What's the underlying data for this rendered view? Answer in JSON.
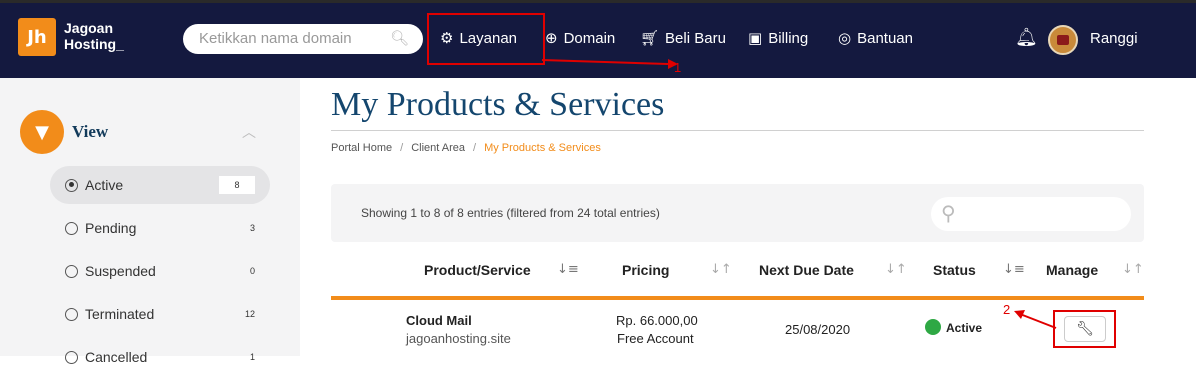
{
  "brand": {
    "logo_glyph": "Jh",
    "line1": "Jagoan",
    "line2": "Hosting_",
    "accent": "#f28c1a",
    "navbar_bg": "#14193f"
  },
  "search": {
    "placeholder": "Ketikkan nama domain"
  },
  "nav": [
    {
      "icon": "gears-icon",
      "label": "Layanan"
    },
    {
      "icon": "globe-icon",
      "label": "Domain"
    },
    {
      "icon": "cart-icon",
      "label": "Beli Baru"
    },
    {
      "icon": "billing-icon",
      "label": "Billing"
    },
    {
      "icon": "lifebuoy-icon",
      "label": "Bantuan"
    }
  ],
  "user": {
    "name": "Ranggi"
  },
  "annotations": {
    "step1": "1",
    "step2": "2",
    "color": "#e00000"
  },
  "sidebar": {
    "title": "View",
    "filters": [
      {
        "label": "Active",
        "count": "8",
        "selected": true
      },
      {
        "label": "Pending",
        "count": "3",
        "selected": false
      },
      {
        "label": "Suspended",
        "count": "0",
        "selected": false
      },
      {
        "label": "Terminated",
        "count": "12",
        "selected": false
      },
      {
        "label": "Cancelled",
        "count": "1",
        "selected": false
      }
    ]
  },
  "page": {
    "title": "My Products & Services",
    "breadcrumb": [
      "Portal Home",
      "Client Area",
      "My Products & Services"
    ]
  },
  "table": {
    "info": "Showing 1 to 8 of 8 entries (filtered from 24 total entries)",
    "columns": [
      "Product/Service",
      "Pricing",
      "Next Due Date",
      "Status",
      "Manage"
    ],
    "rows": [
      {
        "product": "Cloud Mail",
        "domain": "jagoanhosting.site",
        "price": "Rp. 66.000,00",
        "price_note": "Free Account",
        "due": "25/08/2020",
        "status": "Active"
      }
    ]
  }
}
